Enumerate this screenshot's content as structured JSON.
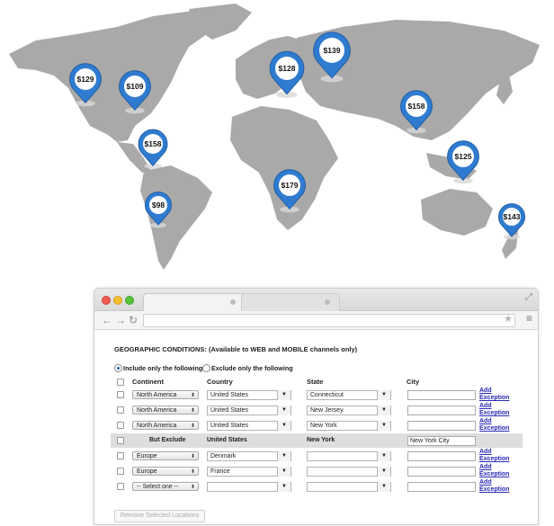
{
  "map": {
    "pins": [
      {
        "label": "$129"
      },
      {
        "label": "$109"
      },
      {
        "label": "$158"
      },
      {
        "label": "$98"
      },
      {
        "label": "$179"
      },
      {
        "label": "$128"
      },
      {
        "label": "$139"
      },
      {
        "label": "$158"
      },
      {
        "label": "$125"
      },
      {
        "label": "$143"
      }
    ]
  },
  "form": {
    "title": "GEOGRAPHIC CONDITIONS:",
    "title_note": "(Available to WEB and MOBILE channels only)",
    "radio_include": "Include only the following",
    "radio_exclude": "Exclude only the following",
    "selected_mode": "include",
    "headers": {
      "continent": "Continent",
      "country": "Country",
      "state": "State",
      "city": "City"
    },
    "rows": [
      {
        "continent": "North America",
        "country": "United States",
        "state": "Connecticut",
        "city": "",
        "action": "Add Exception"
      },
      {
        "continent": "North America",
        "country": "United States",
        "state": "New Jersey",
        "city": "",
        "action": "Add Exception"
      },
      {
        "continent": "North America",
        "country": "United States",
        "state": "New York",
        "city": "",
        "action": "Add Exception"
      },
      {
        "continent": "But Exclude",
        "country": "United States",
        "state": "New York",
        "city": "New York City",
        "action": ""
      },
      {
        "continent": "Europe",
        "country": "Denmark",
        "state": "",
        "city": "",
        "action": "Add Exception"
      },
      {
        "continent": "Europe",
        "country": "France",
        "state": "",
        "city": "",
        "action": "Add Exception"
      },
      {
        "continent": "-- Select one --",
        "country": "",
        "state": "",
        "city": "",
        "action": "Add Exception"
      }
    ],
    "remove_button": "Remove Selected Locations"
  },
  "colors": {
    "pin": "#2f7bd0",
    "land": "#a9a9a9",
    "link": "#2b2bb8"
  }
}
